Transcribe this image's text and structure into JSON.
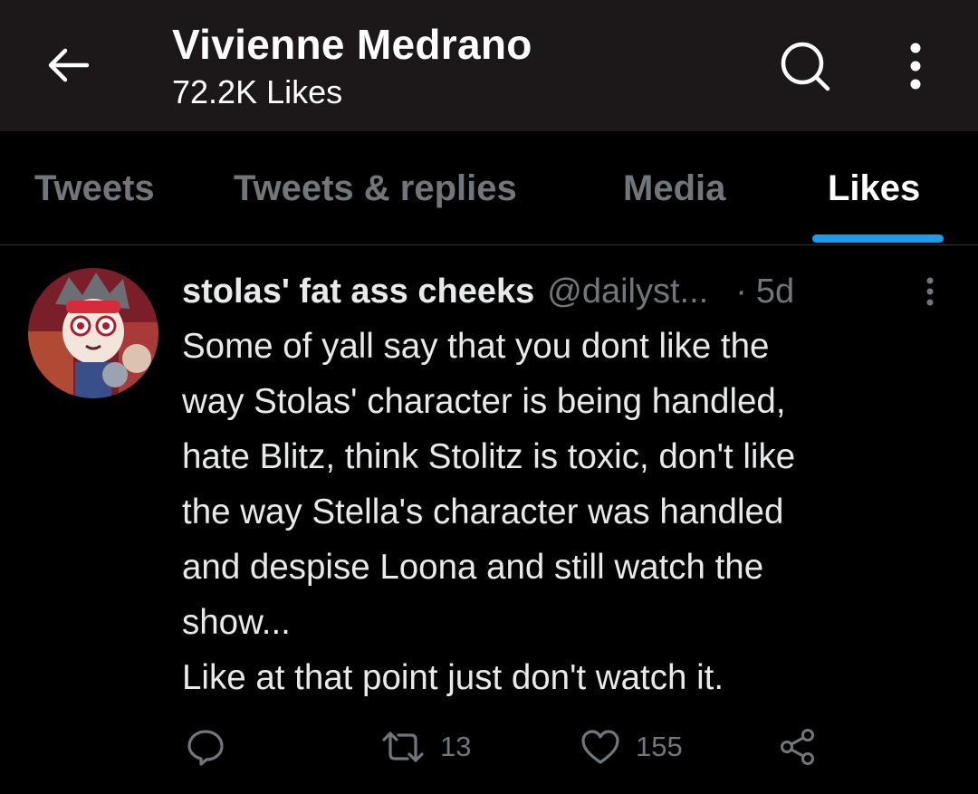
{
  "header": {
    "title": "Vivienne Medrano",
    "subtitle": "72.2K Likes",
    "back_icon": "arrow-left-icon",
    "search_icon": "search-icon",
    "more_icon": "more-vertical-icon"
  },
  "tabs": [
    {
      "label": "Tweets",
      "active": false
    },
    {
      "label": "Tweets & replies",
      "active": false
    },
    {
      "label": "Media",
      "active": false
    },
    {
      "label": "Likes",
      "active": true
    }
  ],
  "tweet": {
    "author_name": "stolas' fat ass cheeks",
    "handle": "@dailyst...",
    "separator": "·",
    "time": "5d",
    "text": "Some of yall say that you dont like the\nway Stolas' character is being handled,\nhate Blitz, think Stolitz is toxic, don't like\nthe way Stella's character was handled\nand despise Loona and still watch the\nshow...\nLike at that point just don't watch it.",
    "retweets": "13",
    "likes": "155",
    "action_icons": [
      "reply-icon",
      "retweet-icon",
      "heart-icon",
      "share-icon"
    ]
  },
  "colors": {
    "background": "#000000",
    "header_bg": "#1c1718",
    "accent": "#1d9bf0",
    "secondary_text": "#71767b",
    "primary_text": "#e7e9ea"
  }
}
